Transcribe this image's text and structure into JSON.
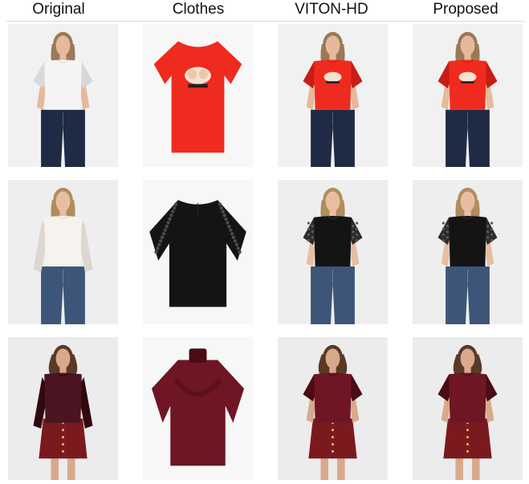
{
  "columns": [
    "Original",
    "Clothes",
    "VITON-HD",
    "Proposed"
  ],
  "rows": [
    {
      "top_color": "#f4f4f4",
      "top_shadow": "#d8d8d8",
      "garment_color": "#ef2b1f",
      "garment_shadow": "#c81d13",
      "bottom_color": "#1f2b45",
      "hair_color": "#9a7a55",
      "skin_color": "#e6b99c",
      "background": "#f1f1f1",
      "garment_type": "tshirt",
      "bottom_type": "jeans"
    },
    {
      "top_color": "#f6f3ee",
      "top_shadow": "#ddd8cf",
      "garment_color": "#141414",
      "garment_shadow": "#2c2c2c",
      "bottom_color": "#3d5578",
      "hair_color": "#b08c5e",
      "skin_color": "#e8bea3",
      "background": "#eeeeee",
      "garment_type": "lace-tee",
      "bottom_type": "jeans"
    },
    {
      "top_color": "#4a1420",
      "top_shadow": "#32080f",
      "garment_color": "#6e1623",
      "garment_shadow": "#4a0c15",
      "bottom_color": "#7b1a1e",
      "hair_color": "#5a3a26",
      "skin_color": "#d9a98c",
      "background": "#ececec",
      "garment_type": "velvet-tee",
      "bottom_type": "skirt"
    }
  ]
}
